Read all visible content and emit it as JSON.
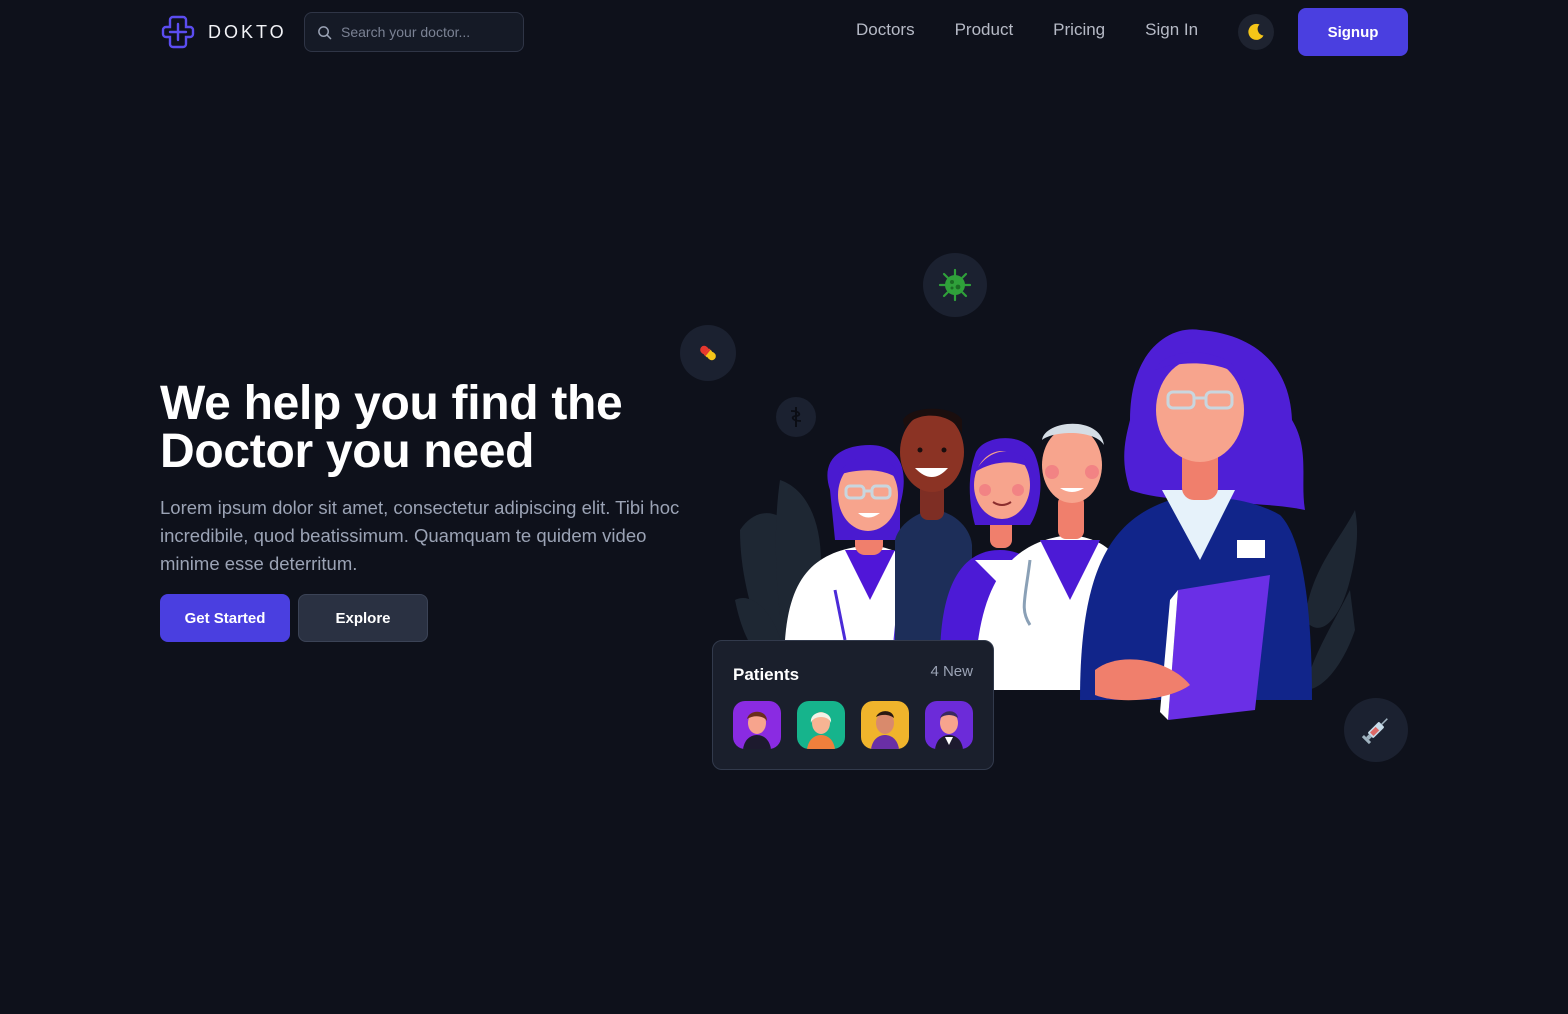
{
  "brand": {
    "name": "DOKTO",
    "accent": "#4a3fe0"
  },
  "search": {
    "placeholder": "Search your doctor..."
  },
  "nav": {
    "links": [
      {
        "label": "Doctors"
      },
      {
        "label": "Product"
      },
      {
        "label": "Pricing"
      },
      {
        "label": "Sign In"
      }
    ],
    "theme_icon": "moon-icon",
    "signup_label": "Signup"
  },
  "hero": {
    "title_line1": "We help you find the",
    "title_line2": "Doctor you need",
    "description": "Lorem ipsum dolor sit amet, consectetur adipiscing elit. Tibi hoc incredibile, quod beatissimum. Quamquam te quidem video minime esse deterritum.",
    "primary_label": "Get Started",
    "secondary_label": "Explore"
  },
  "floating_icons": [
    "pill-icon",
    "virus-icon",
    "caduceus-icon",
    "syringe-icon"
  ],
  "patients": {
    "title": "Patients",
    "badge": "4 New",
    "avatar_colors": [
      "#8a2be2",
      "#16b48c",
      "#f0b42c",
      "#6c2bd9"
    ]
  }
}
